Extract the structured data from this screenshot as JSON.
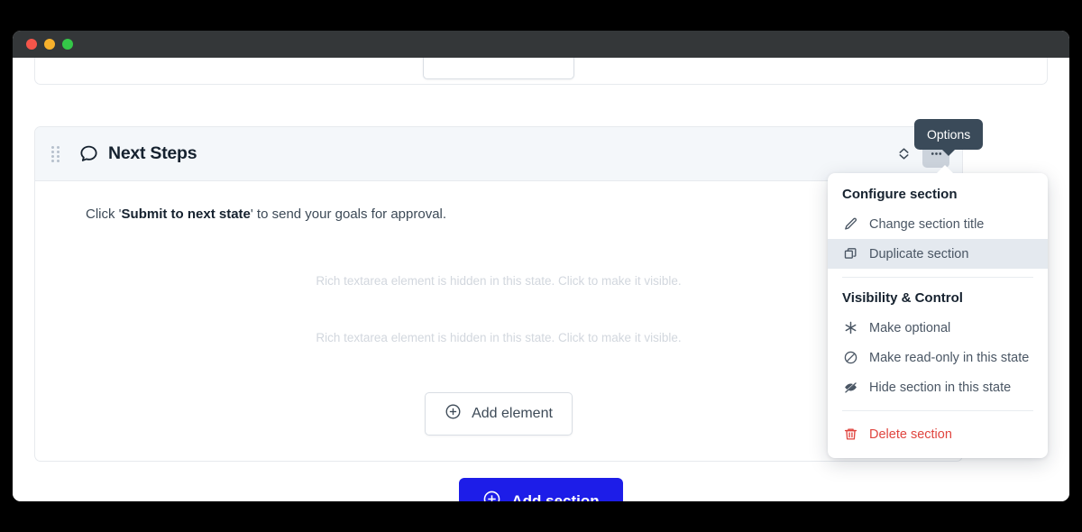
{
  "window": {
    "traffic_lights": [
      "close",
      "minimize",
      "zoom"
    ],
    "colors": {
      "close": "#f5554a",
      "minimize": "#f7b12c",
      "zoom": "#34c748",
      "titlebar": "#343739"
    }
  },
  "section": {
    "drag_handle_name": "drag-handle",
    "icon": "speech-bubble-icon",
    "title": "Next Steps",
    "collapse_icon": "collapse-icon",
    "options_icon": "ellipsis-icon",
    "intro": {
      "before": "Click '",
      "bold": "Submit to next state",
      "after": "' to send your goals for approval."
    },
    "hidden_elements": [
      "Rich textarea element is hidden in this state. Click to make it visible.",
      "Rich textarea element is hidden in this state. Click to make it visible."
    ],
    "add_element_label": "Add element",
    "add_element_icon": "plus-circle-icon"
  },
  "add_section": {
    "label": "Add section",
    "icon": "plus-circle-icon",
    "color": "#1d1de8"
  },
  "tooltip": {
    "text": "Options",
    "background": "#3a4a59"
  },
  "menu": {
    "groups": [
      {
        "heading": "Configure section",
        "items": [
          {
            "label": "Change section title",
            "icon": "pencil-icon",
            "hovered": false,
            "danger": false
          },
          {
            "label": "Duplicate section",
            "icon": "copy-icon",
            "hovered": true,
            "danger": false
          }
        ]
      },
      {
        "heading": "Visibility & Control",
        "items": [
          {
            "label": "Make optional",
            "icon": "asterisk-icon",
            "hovered": false,
            "danger": false
          },
          {
            "label": "Make read-only in this state",
            "icon": "ban-icon",
            "hovered": false,
            "danger": false
          },
          {
            "label": "Hide section in this state",
            "icon": "eye-off-icon",
            "hovered": false,
            "danger": false
          }
        ]
      }
    ],
    "delete": {
      "label": "Delete section",
      "icon": "trash-icon",
      "color": "#e0453f"
    }
  }
}
